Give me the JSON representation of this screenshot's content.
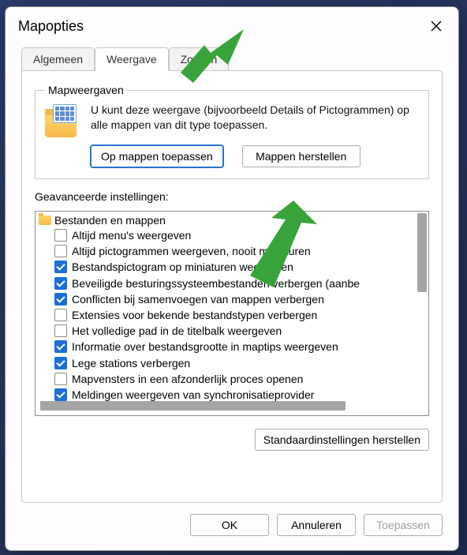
{
  "window": {
    "title": "Mapopties"
  },
  "tabs": {
    "general": "Algemeen",
    "view": "Weergave",
    "search": "Zoeken"
  },
  "mapweergaven": {
    "legend": "Mapweergaven",
    "description": "U kunt deze weergave (bijvoorbeeld Details of Pictogrammen) op alle mappen van dit type toepassen.",
    "apply_button": "Op mappen toepassen",
    "reset_button": "Mappen herstellen"
  },
  "advanced": {
    "label": "Geavanceerde instellingen:",
    "root": "Bestanden en mappen",
    "items": [
      {
        "checked": false,
        "label": "Altijd menu's weergeven"
      },
      {
        "checked": false,
        "label": "Altijd pictogrammen weergeven, nooit miniaturen"
      },
      {
        "checked": true,
        "label": "Bestandspictogram op miniaturen weergeven"
      },
      {
        "checked": true,
        "label": "Beveiligde besturingssysteembestanden verbergen (aanbe"
      },
      {
        "checked": true,
        "label": "Conflicten bij samenvoegen van mappen verbergen"
      },
      {
        "checked": false,
        "label": "Extensies voor bekende bestandstypen verbergen"
      },
      {
        "checked": false,
        "label": "Het volledige pad in de titelbalk weergeven"
      },
      {
        "checked": true,
        "label": "Informatie over bestandsgrootte in maptips weergeven"
      },
      {
        "checked": true,
        "label": "Lege stations verbergen"
      },
      {
        "checked": false,
        "label": "Mapvensters in een afzonderlijk proces openen"
      },
      {
        "checked": true,
        "label": "Meldingen weergeven van synchronisatieprovider"
      }
    ],
    "restore_defaults": "Standaardinstellingen herstellen"
  },
  "buttons": {
    "ok": "OK",
    "cancel": "Annuleren",
    "apply": "Toepassen"
  }
}
